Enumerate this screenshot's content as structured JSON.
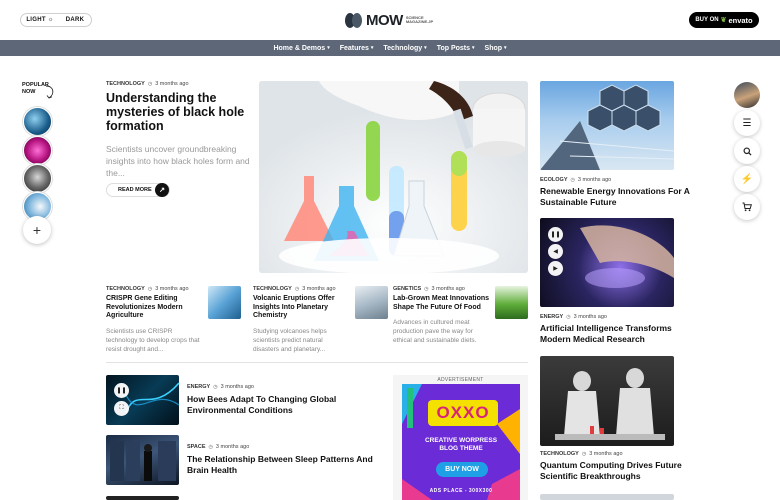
{
  "header": {
    "mode_light": "LIGHT",
    "mode_dark": "DARK",
    "logo_text": "MOW",
    "logo_sub": "SCIENCE MAGAZINE.JP",
    "buy_prefix": "BUY ON",
    "buy_brand": "envato"
  },
  "nav": [
    {
      "label": "Home & Demos"
    },
    {
      "label": "Features"
    },
    {
      "label": "Technology"
    },
    {
      "label": "Top Posts"
    },
    {
      "label": "Shop"
    }
  ],
  "popular": {
    "label_line1": "POPULAR",
    "label_line2": "NOW",
    "add_icon": "+"
  },
  "time_ago": "3 months ago",
  "hero": {
    "category": "TECHNOLOGY",
    "title": "Understanding the mysteries of black hole formation",
    "excerpt": "Scientists uncover groundbreaking insights into how black holes form and the...",
    "read_more": "READ MORE"
  },
  "small_articles": [
    {
      "category": "TECHNOLOGY",
      "title": "CRISPR Gene Editing Revolutionizes Modern Agriculture",
      "excerpt": "Scientists use CRISPR technology to develop crops that resist drought and..."
    },
    {
      "category": "TECHNOLOGY",
      "title": "Volcanic Eruptions Offer Insights Into Planetary Chemistry",
      "excerpt": "Studying volcanoes helps scientists predict natural disasters and planetary..."
    },
    {
      "category": "GENETICS",
      "title": "Lab-Grown Meat Innovations Shape The Future Of Food",
      "excerpt": "Advances in cultured meat production pave the way for ethical and sustainable diets."
    }
  ],
  "list_articles": [
    {
      "category": "ENERGY",
      "title": "How Bees Adapt To Changing Global Environmental Conditions"
    },
    {
      "category": "SPACE",
      "title": "The Relationship Between Sleep Patterns And Brain Health"
    }
  ],
  "ad": {
    "label": "ADVERTISEMENT",
    "brand": "OXXO",
    "tagline_1": "CREATIVE WORPRESS",
    "tagline_2": "BLOG THEME",
    "cta": "BUY NOW",
    "place": "ADS PLACE - 300X300"
  },
  "right_articles": [
    {
      "category": "ECOLOGY",
      "title": "Renewable Energy Innovations For A Sustainable Future"
    },
    {
      "category": "ENERGY",
      "title": "Artificial Intelligence Transforms Modern Medical Research"
    },
    {
      "category": "TECHNOLOGY",
      "title": "Quantum Computing Drives Future Scientific Breakthroughs"
    }
  ],
  "colors": {
    "nav_bg": "#5d6777",
    "ad_purple": "#6b2bd6",
    "ad_yellow": "#f5e100",
    "ad_pink": "#e83a8f"
  }
}
